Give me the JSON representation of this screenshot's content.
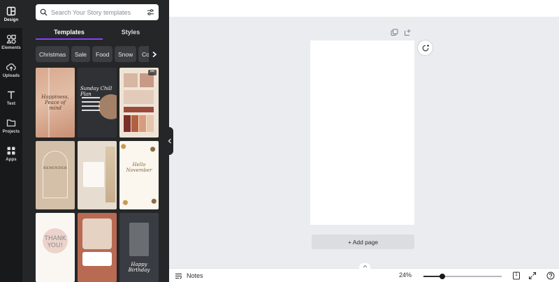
{
  "sidebar": {
    "items": [
      {
        "label": "Design",
        "icon": "layout-icon"
      },
      {
        "label": "Elements",
        "icon": "shapes-icon"
      },
      {
        "label": "Uploads",
        "icon": "cloud-upload-icon"
      },
      {
        "label": "Text",
        "icon": "text-t-icon"
      },
      {
        "label": "Projects",
        "icon": "folder-icon"
      },
      {
        "label": "Apps",
        "icon": "apps-grid-icon"
      }
    ]
  },
  "panel": {
    "search_placeholder": "Search Your Story templates",
    "tabs": [
      "Templates",
      "Styles"
    ],
    "chips": [
      "Christmas",
      "Sale",
      "Food",
      "Snow",
      "Collage"
    ]
  },
  "templates": [
    {
      "text": "Happiness, Peace of mind"
    },
    {
      "text": "Sunday Chill Plan"
    },
    {
      "text": ""
    },
    {
      "text": "REMINDER"
    },
    {
      "text": ""
    },
    {
      "text": "Hello November"
    },
    {
      "text": "THANK YOU!"
    },
    {
      "text": ""
    },
    {
      "text": "Happy Birthday"
    }
  ],
  "canvas": {
    "add_page_label": "+ Add page"
  },
  "bottombar": {
    "notes_label": "Notes",
    "zoom": "24%",
    "zoom_fraction": 0.24,
    "page_count": "1"
  },
  "colors": {
    "accent": "#8b3dff",
    "rail_bg": "#18191b",
    "panel_bg": "#252627",
    "workspace_bg": "#ebecf0"
  }
}
